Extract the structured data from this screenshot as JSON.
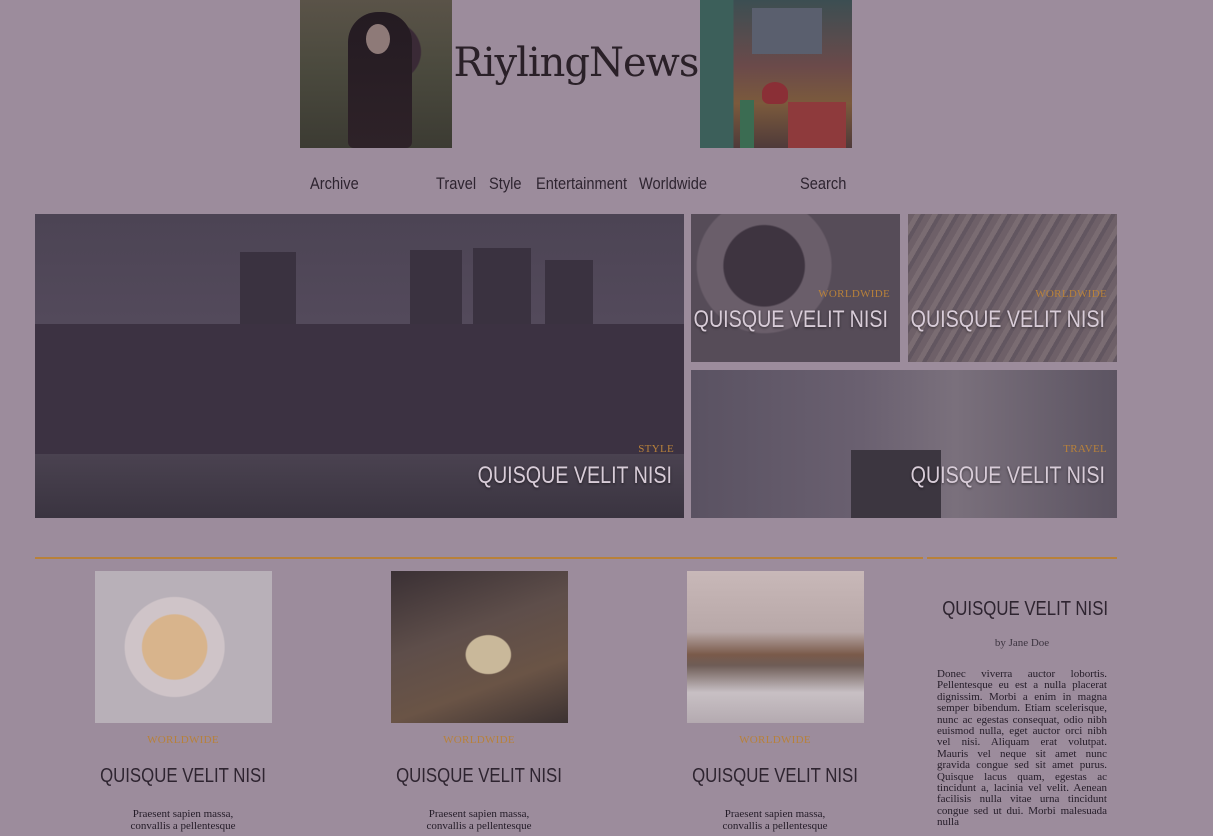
{
  "header": {
    "logo": "RiylingNews",
    "thumb_left": "woman-in-field-photo",
    "thumb_right": "toy-shelf-photo"
  },
  "nav": {
    "items": [
      {
        "label": "Archive"
      },
      {
        "label": "Travel"
      },
      {
        "label": "Style"
      },
      {
        "label": "Entertainment"
      },
      {
        "label": "Worldwide"
      },
      {
        "label": "Search"
      }
    ]
  },
  "featured": {
    "main": {
      "category": "STYLE",
      "title": "QUISQUE VELIT NISI"
    },
    "top_right_1": {
      "category": "WORLDWIDE",
      "title": "QUISQUE VELIT NISI"
    },
    "top_right_2": {
      "category": "WORLDWIDE",
      "title": "QUISQUE VELIT NISI"
    },
    "bottom_right": {
      "category": "TRAVEL",
      "title": "QUISQUE VELIT NISI"
    }
  },
  "cards": [
    {
      "category": "WORLDWIDE",
      "title": "QUISQUE VELIT NISI",
      "excerpt": "Praesent sapien massa, convallis a pellentesque"
    },
    {
      "category": "WORLDWIDE",
      "title": "QUISQUE VELIT NISI",
      "excerpt": "Praesent sapien massa, convallis a pellentesque"
    },
    {
      "category": "WORLDWIDE",
      "title": "QUISQUE VELIT NISI",
      "excerpt": "Praesent sapien massa, convallis a pellentesque"
    }
  ],
  "sidebar": {
    "title": "QUISQUE VELIT NISI",
    "byline": "by Jane Doe",
    "body": "Donec viverra auctor lobortis. Pellentesque eu est a nulla placerat dignissim. Morbi a enim in magna semper bibendum. Etiam scelerisque, nunc ac egestas consequat, odio nibh euismod nulla, eget auctor orci nibh vel nisi. Aliquam erat volutpat. Mauris vel neque sit amet nunc gravida congue sed sit amet purus. Quisque lacus quam, egestas ac tincidunt a, lacinia vel velit. Aenean facilisis nulla vitae urna tincidunt congue sed ut dui. Morbi malesuada nulla"
  },
  "colors": {
    "accent": "#b8813a",
    "background": "#9c8c9c",
    "text": "#2e2430"
  }
}
